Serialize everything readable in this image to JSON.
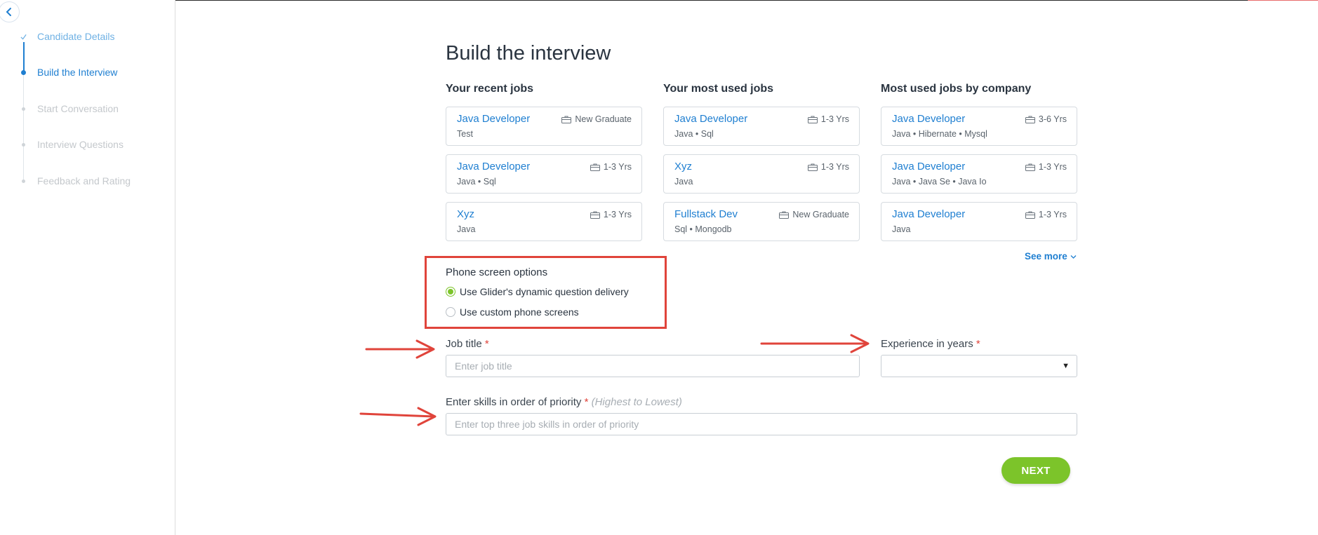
{
  "sidebar": {
    "back_icon": "chevron-left-icon",
    "steps": [
      {
        "label": "Candidate Details",
        "state": "done"
      },
      {
        "label": "Build the Interview",
        "state": "active"
      },
      {
        "label": "Start Conversation",
        "state": "pending"
      },
      {
        "label": "Interview Questions",
        "state": "pending"
      },
      {
        "label": "Feedback and Rating",
        "state": "pending"
      }
    ]
  },
  "main": {
    "title": "Build the interview",
    "columns": [
      {
        "title": "Your recent jobs",
        "jobs": [
          {
            "title": "Java Developer",
            "experience": "New Graduate",
            "skills": "Test"
          },
          {
            "title": "Java Developer",
            "experience": "1-3 Yrs",
            "skills": "Java • Sql"
          },
          {
            "title": "Xyz",
            "experience": "1-3 Yrs",
            "skills": "Java"
          }
        ]
      },
      {
        "title": "Your most used jobs",
        "jobs": [
          {
            "title": "Java Developer",
            "experience": "1-3 Yrs",
            "skills": "Java • Sql"
          },
          {
            "title": "Xyz",
            "experience": "1-3 Yrs",
            "skills": "Java"
          },
          {
            "title": "Fullstack Dev",
            "experience": "New Graduate",
            "skills": "Sql • Mongodb"
          }
        ]
      },
      {
        "title": "Most used jobs by company",
        "jobs": [
          {
            "title": "Java Developer",
            "experience": "3-6 Yrs",
            "skills": "Java • Hibernate • Mysql"
          },
          {
            "title": "Java Developer",
            "experience": "1-3 Yrs",
            "skills": "Java • Java Se • Java Io"
          },
          {
            "title": "Java Developer",
            "experience": "1-3 Yrs",
            "skills": "Java"
          }
        ]
      }
    ],
    "see_more": "See more",
    "phone_screen": {
      "title": "Phone screen options",
      "options": [
        {
          "label": "Use Glider's dynamic question delivery",
          "checked": true
        },
        {
          "label": "Use custom phone screens",
          "checked": false
        }
      ]
    },
    "form": {
      "job_title_label": "Job title",
      "job_title_placeholder": "Enter job title",
      "job_title_value": "",
      "experience_label": "Experience in years",
      "experience_value": "",
      "skills_label": "Enter skills in order of priority",
      "skills_hint": "(Highest to Lowest)",
      "skills_placeholder": "Enter top three job skills in order of priority",
      "skills_value": "",
      "required_mark": "*"
    },
    "next_label": "NEXT"
  },
  "colors": {
    "accent_blue": "#1f7fd1",
    "accent_green": "#7cc42a",
    "annotation_red": "#e0443b"
  }
}
